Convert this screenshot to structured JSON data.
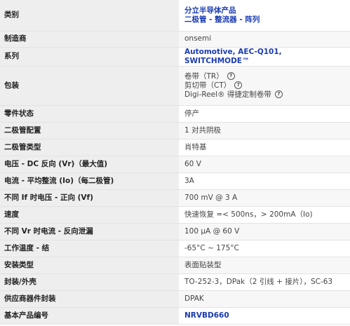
{
  "rows": [
    {
      "label": "类别",
      "links": [
        "分立半导体产品",
        "二极管 - 整流器 - 阵列"
      ]
    },
    {
      "label": "制造商",
      "value": "onsemi"
    },
    {
      "label": "系列",
      "link": "Automotive, AEC-Q101, SWITCHMODE™"
    },
    {
      "label": "包装",
      "packaging": [
        "卷带（TR）",
        "剪切带（CT）",
        "Digi-Reel® 得捷定制卷带"
      ]
    },
    {
      "label": "零件状态",
      "value": "停产"
    },
    {
      "label": "二极管配置",
      "value": "1 对共阴极"
    },
    {
      "label": "二极管类型",
      "value": "肖特基"
    },
    {
      "label": "电压 - DC 反向 (Vr)（最大值)",
      "value": "60 V"
    },
    {
      "label": "电流 - 平均整流 (Io)（每二极管)",
      "value": "3A"
    },
    {
      "label": "不同 If 时电压 - 正向 (Vf)",
      "value": "700 mV @ 3 A"
    },
    {
      "label": "速度",
      "value": "快速恢复 =< 500ns，> 200mA（Io)"
    },
    {
      "label": "不同 Vr 时电流 - 反向泄漏",
      "value": "100 µA @ 60 V"
    },
    {
      "label": "工作温度 - 结",
      "value": "-65°C ~ 175°C"
    },
    {
      "label": "安装类型",
      "value": "表面贴装型"
    },
    {
      "label": "封装/外壳",
      "value": "TO-252-3，DPak（2 引线 + 接片），SC-63"
    },
    {
      "label": "供应商器件封装",
      "value": "DPAK"
    },
    {
      "label": "基本产品编号",
      "link": "NRVBD660"
    }
  ],
  "help_icon": "?"
}
